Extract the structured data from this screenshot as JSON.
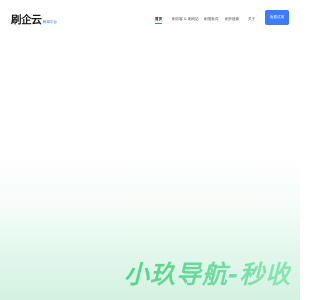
{
  "header": {
    "logo_main": "刷企云",
    "logo_sub": "刷单平台"
  },
  "nav": {
    "items": [
      {
        "label": "首页",
        "active": true
      },
      {
        "label": "刷访客 & 刷网站",
        "active": false
      },
      {
        "label": "刷搜索词",
        "active": false
      },
      {
        "label": "刷外链新",
        "active": false
      },
      {
        "label": "关于",
        "active": false
      }
    ],
    "cta_label": "免费试用"
  },
  "hero": {
    "title": "小玖导航-秒收"
  },
  "colors": {
    "accent": "#3b7bff",
    "hero_green": "#54d38a",
    "footer_tint": "#d3f2e1"
  }
}
